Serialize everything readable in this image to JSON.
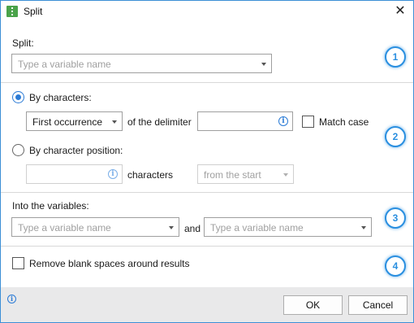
{
  "window": {
    "title": "Split",
    "close_symbol": "✕"
  },
  "split_section": {
    "label": "Split:",
    "input_placeholder": "Type a variable name",
    "step": "1"
  },
  "delimiter_section": {
    "by_characters_label": "By characters:",
    "by_characters_selected": true,
    "occurrence_value": "First occurrence",
    "of_the_delimiter_label": "of the delimiter",
    "match_case_label": "Match case",
    "match_case_checked": false,
    "by_position_label": "By character position:",
    "by_position_selected": false,
    "characters_label": "characters",
    "from_value": "from the start",
    "step": "2"
  },
  "variables_section": {
    "label": "Into the variables:",
    "first_placeholder": "Type a variable name",
    "and_label": "and",
    "second_placeholder": "Type a variable name",
    "step": "3"
  },
  "options_section": {
    "remove_blanks_label": "Remove blank spaces around results",
    "remove_blanks_checked": false,
    "step": "4"
  },
  "footer": {
    "ok_label": "OK",
    "cancel_label": "Cancel"
  },
  "icons": {
    "info_glyph": "i"
  }
}
